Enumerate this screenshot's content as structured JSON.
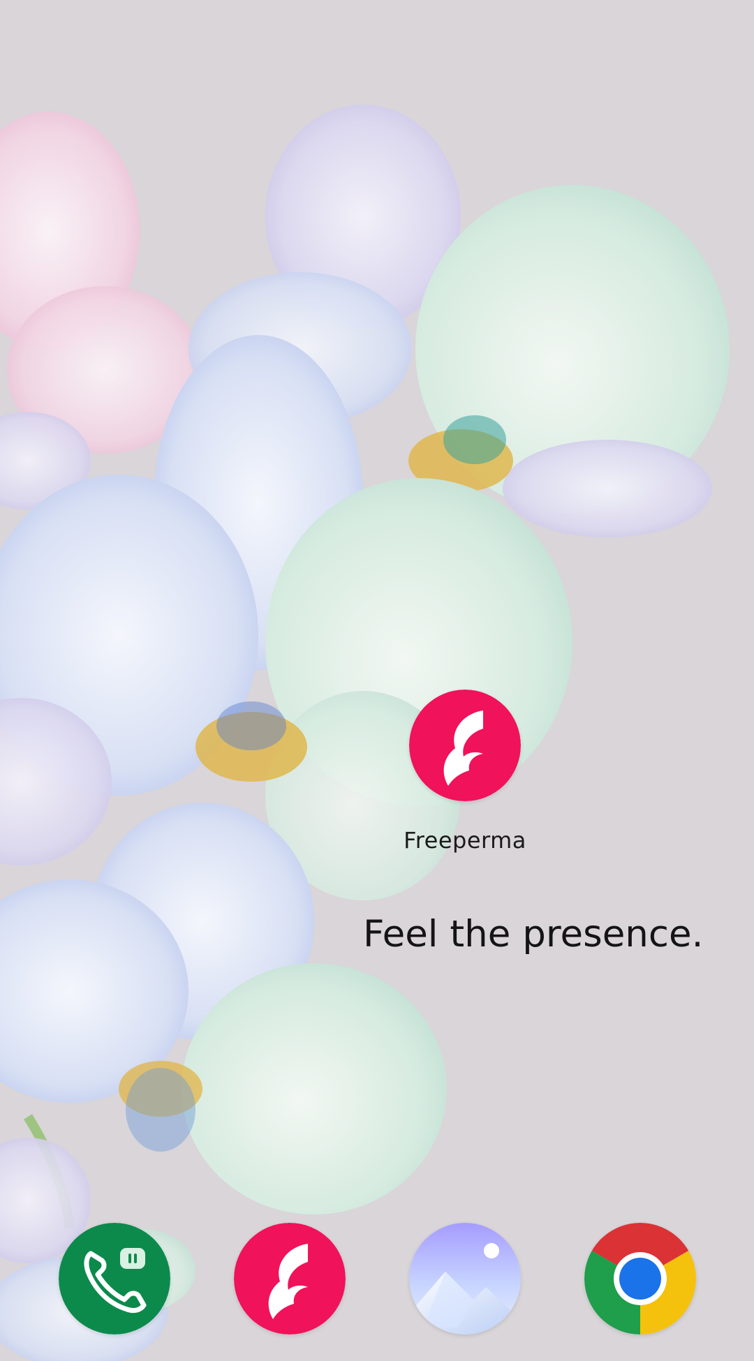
{
  "home_screen": {
    "wallpaper": {
      "icon": "orchid-flowers-wallpaper",
      "background_color": "#d9d5d9"
    },
    "desktop_app": {
      "label": "Freeperma",
      "icon": "freeperma-icon",
      "color": "#f0125a"
    },
    "tagline": "Feel the presence.",
    "dock": [
      {
        "app": "Phone",
        "icon": "phone-icon",
        "color": "#0b8a4c"
      },
      {
        "app": "Freeperma",
        "icon": "freeperma-icon",
        "color": "#f0125a"
      },
      {
        "app": "Gallery",
        "icon": "gallery-icon",
        "color": "#b3b8ff"
      },
      {
        "app": "Chrome",
        "icon": "chrome-icon",
        "color": "#1a73e8"
      }
    ]
  }
}
